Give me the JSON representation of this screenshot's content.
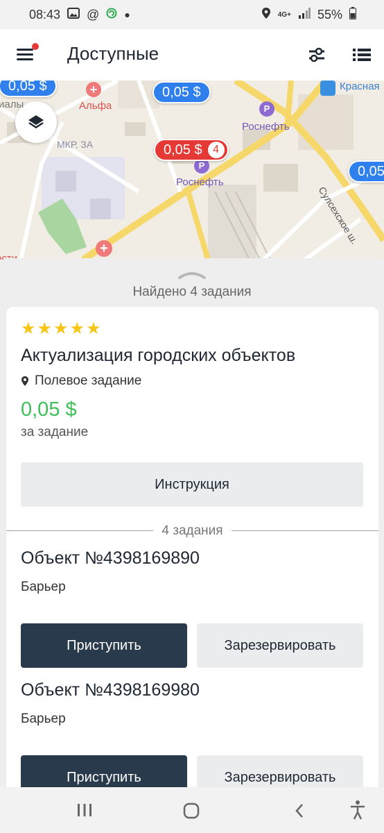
{
  "status_bar": {
    "time": "08:43",
    "network": "4G+",
    "battery": "55%"
  },
  "app_bar": {
    "title": "Доступные"
  },
  "map": {
    "pins": [
      {
        "label": "0,05 $"
      },
      {
        "label": "0,05 $"
      },
      {
        "label": "0,05 $",
        "count": "4"
      },
      {
        "label": "0,05"
      }
    ],
    "places": {
      "alfa": "Альфа",
      "rosneft_1": "Роснефть",
      "rosneft_2": "Роснефть",
      "mkr": "МКР. ЗА",
      "krasnaya": "Красная",
      "street": "Сулсехское ш.",
      "edge_left": "иалы",
      "edge_bottom": "ости"
    },
    "colors": {
      "pin_blue": "#2f80ed",
      "pin_red": "#e53935"
    }
  },
  "sheet": {
    "found_text": "Найдено 4 задания",
    "card": {
      "rating": 5,
      "title": "Актуализация городских объектов",
      "type": "Полевое задание",
      "price": "0,05 $",
      "price_note": "за задание",
      "instruction_button": "Инструкция",
      "count_label": "4 задания",
      "price_color": "#3fbf5a",
      "objects": [
        {
          "title": "Объект №4398169890",
          "subtitle": "Барьер",
          "start_button": "Приступить",
          "reserve_button": "Зарезервировать"
        },
        {
          "title": "Объект №4398169980",
          "subtitle": "Барьер",
          "start_button": "Приступить",
          "reserve_button": "Зарезервировать"
        }
      ]
    }
  },
  "icons": {
    "menu": "menu-icon",
    "filter": "filter-icon",
    "list": "list-icon",
    "layers": "layers-icon",
    "location": "location-pin-icon"
  }
}
